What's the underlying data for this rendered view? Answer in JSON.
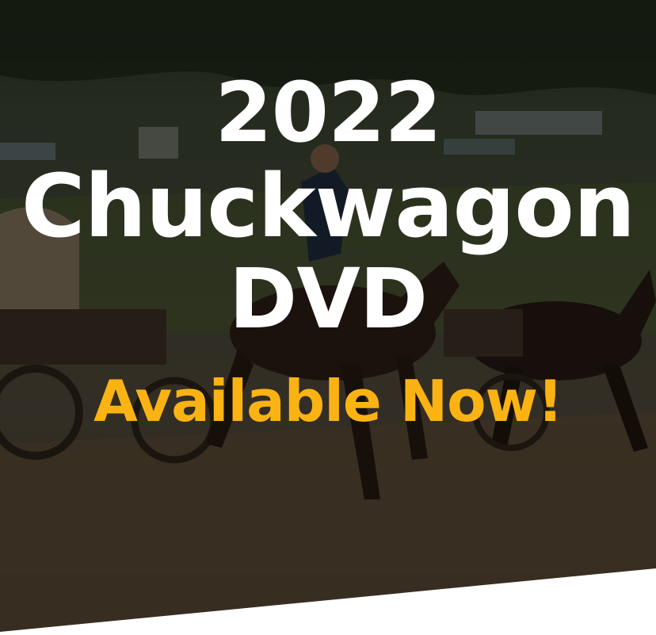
{
  "hero": {
    "title_line1": "2022",
    "title_line2": "Chuckwagon",
    "title_line3": "DVD",
    "tagline": "Available Now!"
  },
  "colors": {
    "title": "#ffffff",
    "tagline": "#fbb314",
    "background_bottom": "#ffffff"
  }
}
